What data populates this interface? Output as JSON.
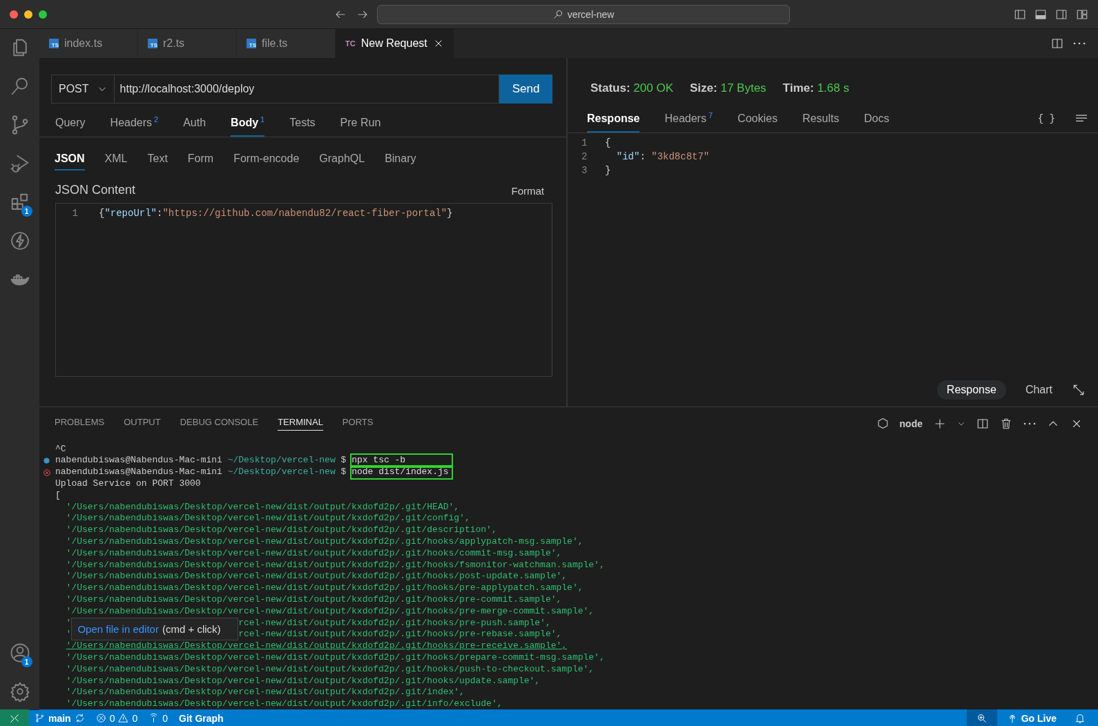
{
  "window": {
    "title": "vercel-new"
  },
  "activity_bar": {
    "top": [
      {
        "kind": "files"
      },
      {
        "kind": "search"
      },
      {
        "kind": "source-control"
      },
      {
        "kind": "run-debug"
      },
      {
        "kind": "extensions",
        "badge": "1"
      },
      {
        "kind": "thunder"
      },
      {
        "kind": "docker"
      }
    ],
    "bottom": [
      {
        "kind": "accounts",
        "badge": "1"
      },
      {
        "kind": "settings"
      }
    ]
  },
  "editor_tabs": [
    {
      "label": "index.ts",
      "icon_text": "TS",
      "kind": "ts",
      "selected": false
    },
    {
      "label": "r2.ts",
      "icon_text": "TS",
      "kind": "ts",
      "selected": false
    },
    {
      "label": "file.ts",
      "icon_text": "TS",
      "kind": "ts",
      "selected": false
    },
    {
      "label": "New Request",
      "icon_text": "TC",
      "kind": "tc",
      "selected": true
    }
  ],
  "request": {
    "method": "POST",
    "url": "http://localhost:3000/deploy",
    "send": "Send",
    "tabs": [
      {
        "label": "Query",
        "selected": false
      },
      {
        "label": "Headers",
        "count": "2",
        "selected": false
      },
      {
        "label": "Auth",
        "selected": false
      },
      {
        "label": "Body",
        "count": "1",
        "selected": true
      },
      {
        "label": "Tests",
        "selected": false
      },
      {
        "label": "Pre Run",
        "selected": false
      }
    ],
    "body_types": [
      {
        "label": "JSON",
        "selected": true
      },
      {
        "label": "XML",
        "selected": false
      },
      {
        "label": "Text",
        "selected": false
      },
      {
        "label": "Form",
        "selected": false
      },
      {
        "label": "Form-encode",
        "selected": false
      },
      {
        "label": "GraphQL",
        "selected": false
      },
      {
        "label": "Binary",
        "selected": false
      }
    ],
    "content_label": "JSON Content",
    "format": "Format",
    "lines": [
      {
        "number": "1",
        "tokens": [
          {
            "text": "{",
            "kind": "punct"
          },
          {
            "text": "\"repoUrl\"",
            "kind": "key"
          },
          {
            "text": ":",
            "kind": "punct"
          },
          {
            "text": "\"https://github.com/nabendu82/react-fiber-portal\"",
            "kind": "string"
          },
          {
            "text": "}",
            "kind": "punct"
          }
        ]
      }
    ]
  },
  "response": {
    "stats": [
      {
        "label": "Status:",
        "value": "200 OK"
      },
      {
        "label": "Size:",
        "value": "17 Bytes"
      },
      {
        "label": "Time:",
        "value": "1.68 s"
      }
    ],
    "tabs": [
      {
        "label": "Response",
        "selected": true
      },
      {
        "label": "Headers",
        "count": "7",
        "selected": false
      },
      {
        "label": "Cookies",
        "selected": false
      },
      {
        "label": "Results",
        "selected": false
      },
      {
        "label": "Docs",
        "selected": false
      }
    ],
    "braces_button": "{ }",
    "lines": [
      {
        "number": "1",
        "tokens": [
          {
            "text": "{",
            "kind": "punct"
          }
        ]
      },
      {
        "number": "2",
        "tokens": [
          {
            "text": "  \"id\"",
            "kind": "key"
          },
          {
            "text": ": ",
            "kind": "punct"
          },
          {
            "text": "\"3kd8c8t7\"",
            "kind": "string"
          }
        ]
      },
      {
        "number": "3",
        "tokens": [
          {
            "text": "}",
            "kind": "punct"
          }
        ]
      }
    ],
    "views": [
      {
        "label": "Response",
        "selected": true
      },
      {
        "label": "Chart",
        "selected": false
      }
    ]
  },
  "panel": {
    "tabs": [
      {
        "label": "PROBLEMS",
        "selected": false
      },
      {
        "label": "OUTPUT",
        "selected": false
      },
      {
        "label": "DEBUG CONSOLE",
        "selected": false
      },
      {
        "label": "TERMINAL",
        "selected": true
      },
      {
        "label": "PORTS",
        "selected": false
      }
    ],
    "terminal_name": "node",
    "lines": [
      {
        "kind": "plain",
        "text": "^C"
      },
      {
        "kind": "prompt",
        "failed": false,
        "user": "nabendubiswas@Nabendus-Mac-mini",
        "path": "~/Desktop/vercel-new",
        "symbol": "$",
        "command": "npx tsc -b",
        "highlighted": true
      },
      {
        "kind": "prompt",
        "failed": true,
        "user": "nabendubiswas@Nabendus-Mac-mini",
        "path": "~/Desktop/vercel-new",
        "symbol": "$",
        "command": "node dist/index.js",
        "highlighted": true
      },
      {
        "kind": "plain",
        "text": "Upload Service on PORT 3000"
      },
      {
        "kind": "plain",
        "text": "["
      },
      {
        "kind": "path",
        "text": "'/Users/nabendubiswas/Desktop/vercel-new/dist/output/kxdofd2p/.git/HEAD',",
        "hovered": false
      },
      {
        "kind": "path",
        "text": "'/Users/nabendubiswas/Desktop/vercel-new/dist/output/kxdofd2p/.git/config',",
        "hovered": false
      },
      {
        "kind": "path",
        "text": "'/Users/nabendubiswas/Desktop/vercel-new/dist/output/kxdofd2p/.git/description',",
        "hovered": false
      },
      {
        "kind": "path",
        "text": "'/Users/nabendubiswas/Desktop/vercel-new/dist/output/kxdofd2p/.git/hooks/applypatch-msg.sample',",
        "hovered": false
      },
      {
        "kind": "path",
        "text": "'/Users/nabendubiswas/Desktop/vercel-new/dist/output/kxdofd2p/.git/hooks/commit-msg.sample',",
        "hovered": false
      },
      {
        "kind": "path",
        "text": "'/Users/nabendubiswas/Desktop/vercel-new/dist/output/kxdofd2p/.git/hooks/fsmonitor-watchman.sample',",
        "hovered": false
      },
      {
        "kind": "path",
        "text": "'/Users/nabendubiswas/Desktop/vercel-new/dist/output/kxdofd2p/.git/hooks/post-update.sample',",
        "hovered": false
      },
      {
        "kind": "path",
        "text": "'/Users/nabendubiswas/Desktop/vercel-new/dist/output/kxdofd2p/.git/hooks/pre-applypatch.sample',",
        "hovered": false
      },
      {
        "kind": "path",
        "text": "'/Users/nabendubiswas/Desktop/vercel-new/dist/output/kxdofd2p/.git/hooks/pre-commit.sample',",
        "hovered": false
      },
      {
        "kind": "path",
        "text": "'/Users/nabendubiswas/Desktop/vercel-new/dist/output/kxdofd2p/.git/hooks/pre-merge-commit.sample',",
        "hovered": false
      },
      {
        "kind": "covered",
        "link": "Open file in editor",
        "hint": "(cmd + click)",
        "rows": [
          {
            "before": "'",
            "after": "rcel-new/dist/output/kxdofd2p/.git/hooks/pre-push.sample',"
          },
          {
            "before": "'",
            "after": "rcel-new/dist/output/kxdofd2p/.git/hooks/pre-rebase.sample',"
          }
        ]
      },
      {
        "kind": "path",
        "text": "'/Users/nabendubiswas/Desktop/vercel-new/dist/output/kxdofd2p/.git/hooks/pre-receive.sample',",
        "hovered": true
      },
      {
        "kind": "path",
        "text": "'/Users/nabendubiswas/Desktop/vercel-new/dist/output/kxdofd2p/.git/hooks/prepare-commit-msg.sample',",
        "hovered": false
      },
      {
        "kind": "path",
        "text": "'/Users/nabendubiswas/Desktop/vercel-new/dist/output/kxdofd2p/.git/hooks/push-to-checkout.sample',",
        "hovered": false
      },
      {
        "kind": "path",
        "text": "'/Users/nabendubiswas/Desktop/vercel-new/dist/output/kxdofd2p/.git/hooks/update.sample',",
        "hovered": false
      },
      {
        "kind": "path",
        "text": "'/Users/nabendubiswas/Desktop/vercel-new/dist/output/kxdofd2p/.git/index',",
        "hovered": false
      },
      {
        "kind": "path",
        "text": "'/Users/nabendubiswas/Desktop/vercel-new/dist/output/kxdofd2p/.git/info/exclude',",
        "hovered": false
      }
    ]
  },
  "status_bar": {
    "branch": "main",
    "errors": "0",
    "warnings": "0",
    "ports": "0",
    "git_graph": "Git Graph",
    "go_live": "Go Live"
  }
}
